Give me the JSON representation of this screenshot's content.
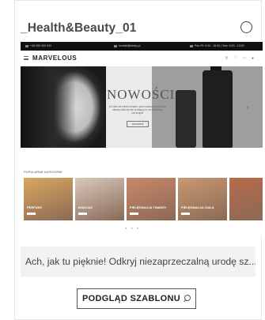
{
  "card": {
    "title": "_Health&Beauty_01",
    "description": "Ach, jak tu pięknie! Odkryj niezaprzeczalną urodę sz...",
    "preview_button_label": "PODGLĄD SZABLONU",
    "preview_button_icon": "search-icon"
  },
  "preview": {
    "topbar": {
      "phone": "+48 000 000 000",
      "email": "kontakt@sklep.pl",
      "hours": "Pon-Pt: 9:00 - 16:00 | Sob: 9:00 - 13:00"
    },
    "brand": "MARVELOUS",
    "hero": {
      "title": "NOWOŚCI",
      "subtitle": "Ut enim ad minim veniam, quis nostrud exercitation ullamco laboris nisi ut aliquip ex ea commodo consequat.",
      "button": "SPRAWDŹ"
    },
    "categories_label": "POPULARNE KATEGORIE",
    "categories": [
      {
        "name": "PERFUMY",
        "color": "#d9a75f"
      },
      {
        "name": "MAKIJAŻ",
        "color": "#d8c9bd"
      },
      {
        "name": "PIELĘGNACJA TWARZY",
        "color": "#c9876a"
      },
      {
        "name": "PIELĘGNACJA CIAŁA",
        "color": "#c99871"
      },
      {
        "name": "",
        "color": "#b86a4c"
      }
    ]
  },
  "colors": {
    "text": "#444444",
    "border": "#e6e6e6",
    "description_bg": "#f2f2f2"
  }
}
